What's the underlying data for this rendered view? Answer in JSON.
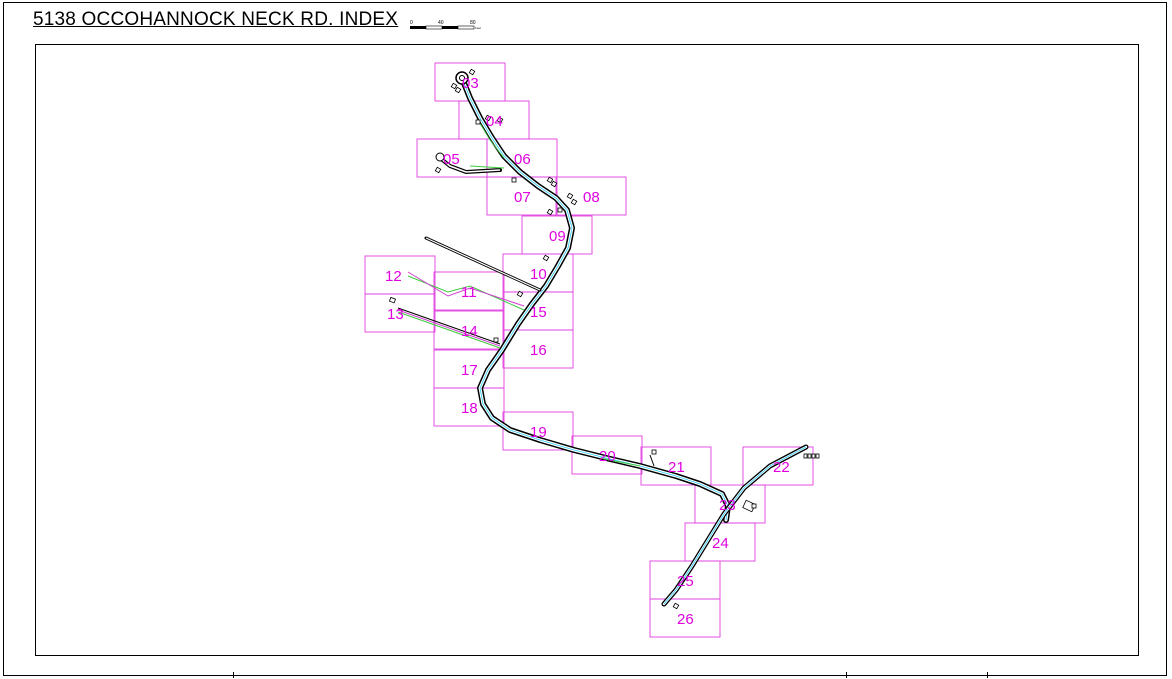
{
  "title": "5138 OCCOHANNOCK NECK RD. INDEX",
  "scale": {
    "labels": [
      "0",
      "40",
      "80"
    ],
    "unit": "Feet"
  },
  "colors": {
    "grid": "#e040e0",
    "label": "#e000e0",
    "road": "#000000",
    "road_fill": "#ffffff",
    "centerline": "#2ad0ff",
    "edge": "#3ccc3c"
  },
  "sheets": [
    {
      "label": "03"
    },
    {
      "label": "04"
    },
    {
      "label": "05"
    },
    {
      "label": "06"
    },
    {
      "label": "07"
    },
    {
      "label": "08"
    },
    {
      "label": "09"
    },
    {
      "label": "10"
    },
    {
      "label": "11"
    },
    {
      "label": "12"
    },
    {
      "label": "13"
    },
    {
      "label": "14"
    },
    {
      "label": "15"
    },
    {
      "label": "16"
    },
    {
      "label": "17"
    },
    {
      "label": "18"
    },
    {
      "label": "19"
    },
    {
      "label": "20"
    },
    {
      "label": "21"
    },
    {
      "label": "22"
    },
    {
      "label": "23"
    },
    {
      "label": "24"
    },
    {
      "label": "25"
    },
    {
      "label": "26"
    }
  ]
}
